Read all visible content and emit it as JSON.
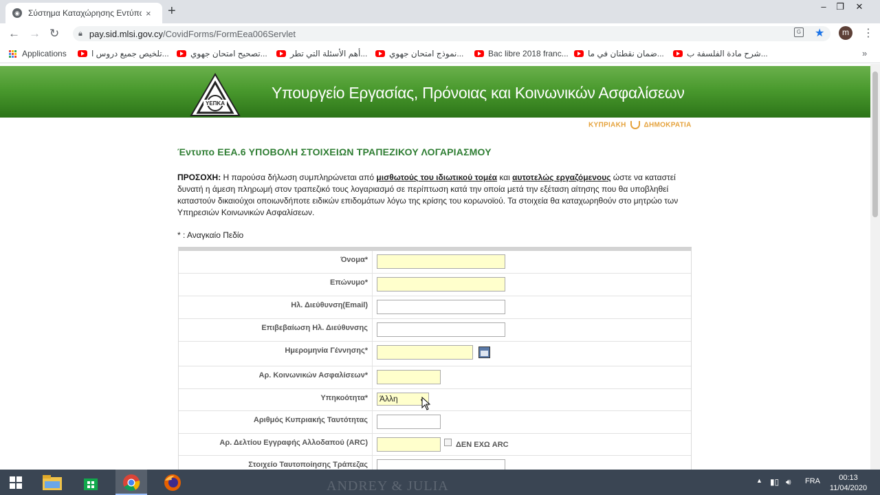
{
  "browser": {
    "tab_title": "Σύστημα Καταχώρησης Εντύπω",
    "tab_close": "×",
    "new_tab": "+",
    "url_host": "pay.sid.mlsi.gov.cy",
    "url_path": "/CovidForms/FormEea006Servlet",
    "profile_initial": "m",
    "window_controls": [
      "–",
      "❐",
      "✕"
    ]
  },
  "bookmarks": [
    {
      "label": "Applications",
      "icon": "apps-grid-icon"
    },
    {
      "label": "تلخيص جميع دروس ا...",
      "icon": "youtube-icon"
    },
    {
      "label": "تصحيح امتحان جهوي...",
      "icon": "youtube-icon"
    },
    {
      "label": "أهم الأسئلة التي تطر...",
      "icon": "youtube-icon"
    },
    {
      "label": "نموذج امتحان جهوي...",
      "icon": "youtube-icon"
    },
    {
      "label": "Bac libre 2018 franc...",
      "icon": "youtube-icon"
    },
    {
      "label": "ضمان نقطتان في ما...",
      "icon": "youtube-icon"
    },
    {
      "label": "شرح مادة الفلسفة ب...",
      "icon": "youtube-icon"
    }
  ],
  "bookmarks_more": "»",
  "header": {
    "logo_text": "ΥΕΠΚΑ",
    "ministry_title": "Υπουργείο Εργασίας, Πρόνοιας και Κοινωνικών Ασφαλίσεων",
    "republic_left": "ΚΥΠΡΙΑΚΗ",
    "republic_right": "ΔΗΜΟΚΡΑΤΙΑ"
  },
  "form": {
    "title": "Έντυπο ΕΕΑ.6 ΥΠΟΒΟΛΗ ΣΤΟΙΧΕΙΩΝ ΤΡΑΠΕΖΙΚΟΥ ΛΟΓΑΡΙΑΣΜΟΥ",
    "notice_label": "ΠΡΟΣΟΧΗ:",
    "notice_part1": " Η παρούσα δήλωση συμπληρώνεται από ",
    "notice_link1": "μισθωτούς του ιδιωτικού τομέα",
    "notice_part2": " και ",
    "notice_link2": "αυτοτελώς εργαζόμενους",
    "notice_part3": " ώστε να καταστεί δυνατή η άμεση πληρωμή στον τραπεζικό τους λογαριασμό σε περίπτωση κατά την οποία μετά την εξέταση αίτησης που θα υποβληθεί καταστούν δικαιούχοι οποιωνδήποτε ειδικών επιδομάτων λόγω της κρίσης του κορωνοϊού. Τα στοιχεία θα καταχωρηθούν στο μητρώο των Υπηρεσιών Κοινωνικών Ασφαλίσεων.",
    "required_note": "* : Αναγκαίο Πεδίο",
    "fields": [
      {
        "label": "Όνομα*",
        "value": ""
      },
      {
        "label": "Επώνυμο*",
        "value": ""
      },
      {
        "label": "Ηλ. Διεύθυνση(Email)",
        "value": ""
      },
      {
        "label": "Επιβεβαίωση Ηλ. Διεύθυνσης",
        "value": ""
      },
      {
        "label": "Ημερομηνία Γέννησης*",
        "value": ""
      },
      {
        "label": "Αρ. Κοινωνικών Ασφαλίσεων*",
        "value": ""
      },
      {
        "label": "Υπηκοότητα*",
        "value": "Άλλη"
      },
      {
        "label": "Αριθμός Κυπριακής Ταυτότητας",
        "value": ""
      },
      {
        "label": "Αρ. Δελτίου Εγγραφής Αλλοδαπού (ARC)",
        "value": ""
      },
      {
        "label": "Στοιχείο Ταυτοποίησης Τράπεζας",
        "value": ""
      }
    ],
    "no_arc_label": "ΔΕΝ ΕΧΩ ARC"
  },
  "taskbar": {
    "watermark": "ANDREY & JULIA",
    "language": "FRA",
    "time": "00:13",
    "date": "11/04/2020"
  },
  "colors": {
    "banner_green": "#4a9a2e",
    "title_green": "#2e7d32",
    "required_yellow": "#ffffcc",
    "republic_gold": "#e5a23b"
  }
}
